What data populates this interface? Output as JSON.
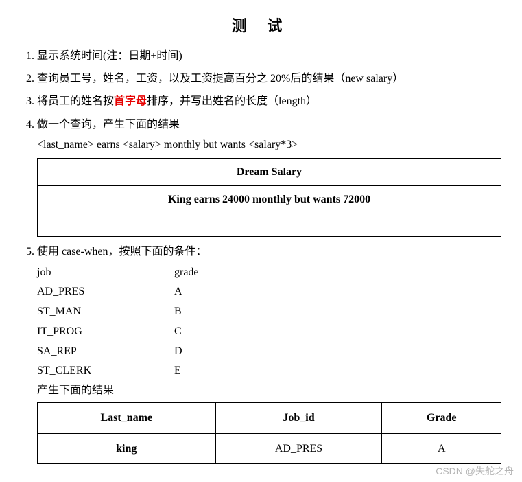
{
  "title": "测 试",
  "items": {
    "q1": "显示系统时间(注：日期+时间)",
    "q2": "查询员工号，姓名，工资，以及工资提高百分之 20%后的结果（new salary）",
    "q3_before": "将员工的姓名按",
    "q3_highlight": "首字母",
    "q3_after": "排序，并写出姓名的长度（length）",
    "q4": "做一个查询，产生下面的结果",
    "q4_template": "<last_name> earns <salary> monthly but wants <salary*3>",
    "q5": "使用 case-when，按照下面的条件：",
    "q5_result_label": "产生下面的结果"
  },
  "dream_table": {
    "header": "Dream Salary",
    "row": "King earns 24000 monthly but wants 72000"
  },
  "jobgrade": {
    "header": {
      "c1": "job",
      "c2": "grade"
    },
    "rows": [
      {
        "c1": "AD_PRES",
        "c2": "A"
      },
      {
        "c1": "ST_MAN",
        "c2": "B"
      },
      {
        "c1": "IT_PROG",
        "c2": "C"
      },
      {
        "c1": "SA_REP",
        "c2": "D"
      },
      {
        "c1": "ST_CLERK",
        "c2": "E"
      }
    ]
  },
  "result_table": {
    "headers": {
      "h1": "Last_name",
      "h2": "Job_id",
      "h3": "Grade"
    },
    "row": {
      "c1": "king",
      "c2": "AD_PRES",
      "c3": "A"
    }
  },
  "watermark": "CSDN @失舵之舟"
}
